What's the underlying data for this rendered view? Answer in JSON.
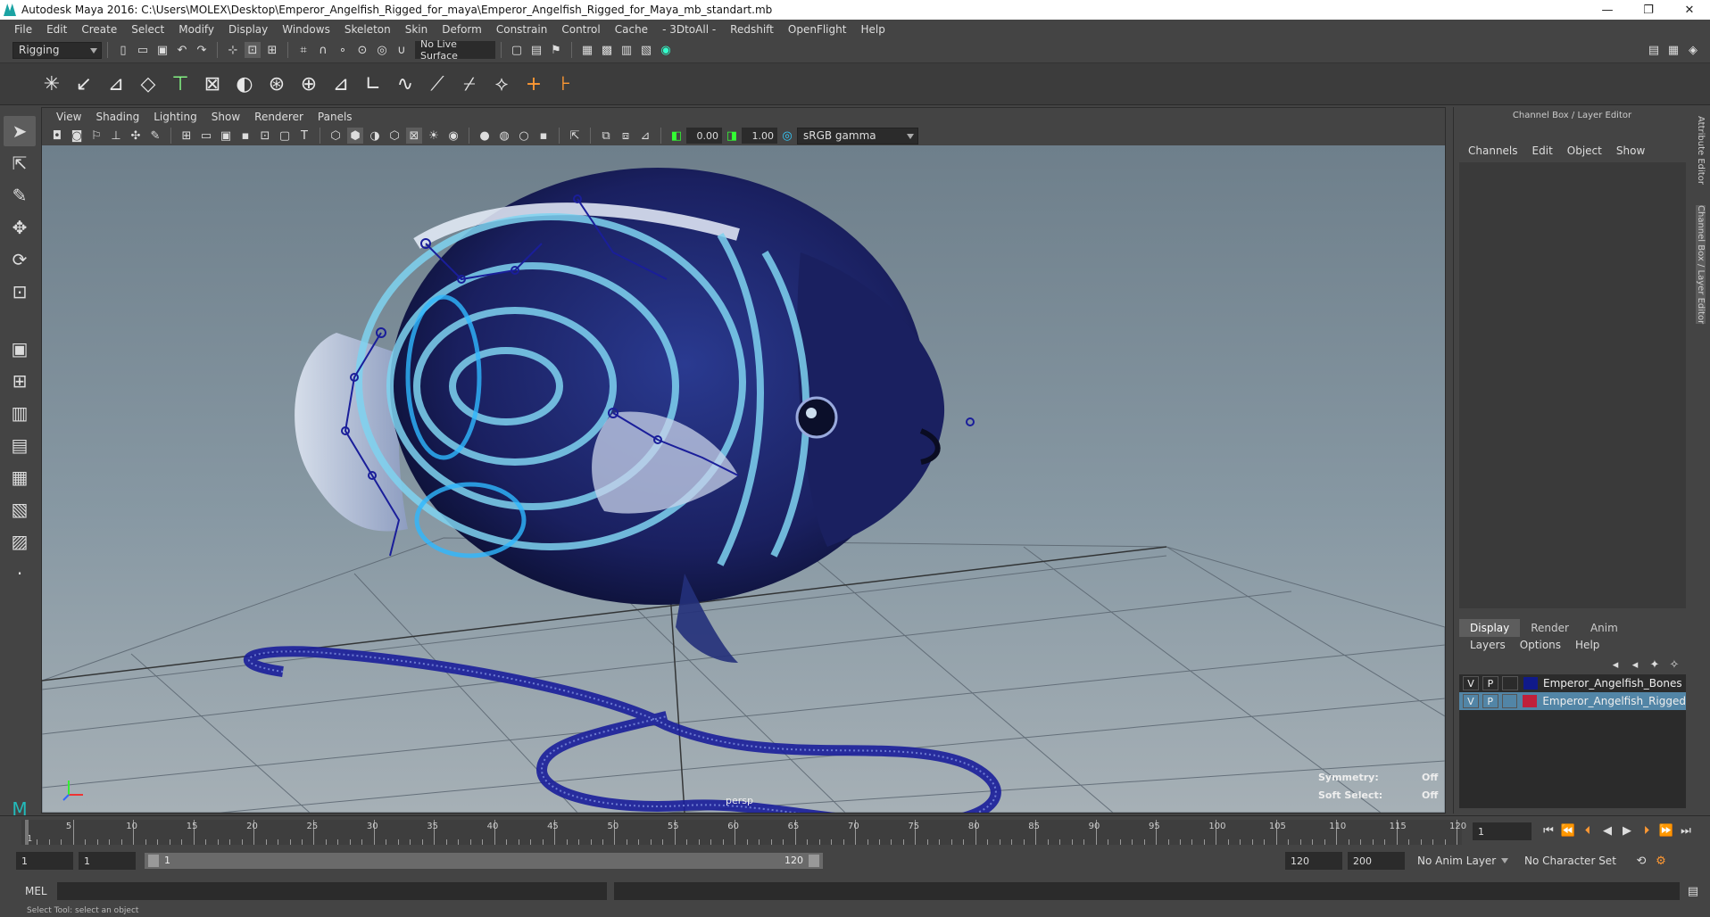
{
  "window": {
    "title": "Autodesk Maya 2016: C:\\Users\\MOLEX\\Desktop\\Emperor_Angelfish_Rigged_for_maya\\Emperor_Angelfish_Rigged_for_Maya_mb_standart.mb",
    "minimize": "—",
    "restore": "❐",
    "close": "✕"
  },
  "menubar": [
    "File",
    "Edit",
    "Create",
    "Select",
    "Modify",
    "Display",
    "Windows",
    "Skeleton",
    "Skin",
    "Deform",
    "Constrain",
    "Control",
    "Cache",
    "- 3DtoAll -",
    "Redshift",
    "OpenFlight",
    "Help"
  ],
  "shelfrow": {
    "menuset": "Rigging",
    "live_surface": "No Live Surface"
  },
  "panel": {
    "menus": [
      "View",
      "Shading",
      "Lighting",
      "Show",
      "Renderer",
      "Panels"
    ],
    "exposure": "0.00",
    "gamma": "1.00",
    "colorspace": "sRGB gamma",
    "camera": "persp",
    "symmetry_label": "Symmetry:",
    "symmetry_value": "Off",
    "softselect_label": "Soft Select:",
    "softselect_value": "Off"
  },
  "rightpanel": {
    "title": "Channel Box / Layer Editor",
    "tabs": [
      "Channels",
      "Edit",
      "Object",
      "Show"
    ],
    "layer_tabs": [
      "Display",
      "Render",
      "Anim"
    ],
    "layer_menu": [
      "Layers",
      "Options",
      "Help"
    ],
    "layers": [
      {
        "v": "V",
        "p": "P",
        "name": "Emperor_Angelfish_Bones",
        "color": "#101a8a"
      },
      {
        "v": "V",
        "p": "P",
        "name": "Emperor_Angelfish_Rigged",
        "color": "#c0203a"
      }
    ],
    "vertical_tabs": [
      "Attribute Editor",
      "Channel Box / Layer Editor"
    ]
  },
  "timeline": {
    "ticks": [
      "5",
      "10",
      "15",
      "20",
      "25",
      "30",
      "35",
      "40",
      "45",
      "50",
      "55",
      "60",
      "65",
      "70",
      "75",
      "80",
      "85",
      "90",
      "95",
      "100",
      "105",
      "110",
      "115",
      "120"
    ],
    "first_tick": "1",
    "current_frame": "1"
  },
  "range": {
    "start": "1",
    "playback_start": "1",
    "slider_start": "1",
    "slider_end": "120",
    "playback_end": "120",
    "end": "200",
    "anim_layer": "No Anim Layer",
    "char_set": "No Character Set"
  },
  "cmdline": {
    "lang": "MEL"
  },
  "helpline": "Select Tool: select an object"
}
